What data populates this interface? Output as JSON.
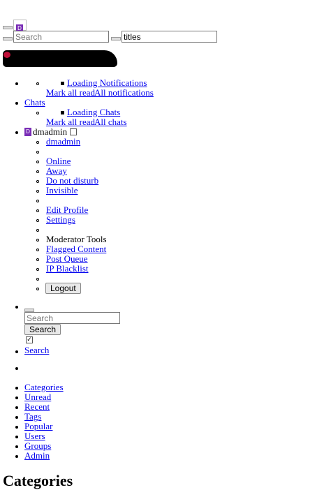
{
  "header": {
    "logo_letter": "D",
    "search_placeholder": "Search",
    "search_value": "titles"
  },
  "notifications": {
    "loading": "Loading Notifications",
    "mark_all_read": "Mark all read",
    "all_link": "All notifications"
  },
  "chats": {
    "title": "Chats",
    "loading": "Loading Chats",
    "mark_all_read": "Mark all read",
    "all_link": "All chats"
  },
  "user_menu": {
    "avatar_letter": "D",
    "username": "dmadmin",
    "profile_link": "dmadmin",
    "status": [
      "Online",
      "Away",
      "Do not disturb",
      "Invisible"
    ],
    "edit_profile": "Edit Profile",
    "settings": "Settings",
    "moderator_heading": "Moderator Tools",
    "moderator_links": [
      "Flagged Content",
      "Post Queue",
      "IP Blacklist"
    ],
    "logout": "Logout"
  },
  "search_block": {
    "placeholder": "Search",
    "button": "Search",
    "link": "Search"
  },
  "main_nav": [
    "Categories",
    "Unread",
    "Recent",
    "Tags",
    "Popular",
    "Users",
    "Groups",
    "Admin"
  ],
  "page_title": "Categories"
}
